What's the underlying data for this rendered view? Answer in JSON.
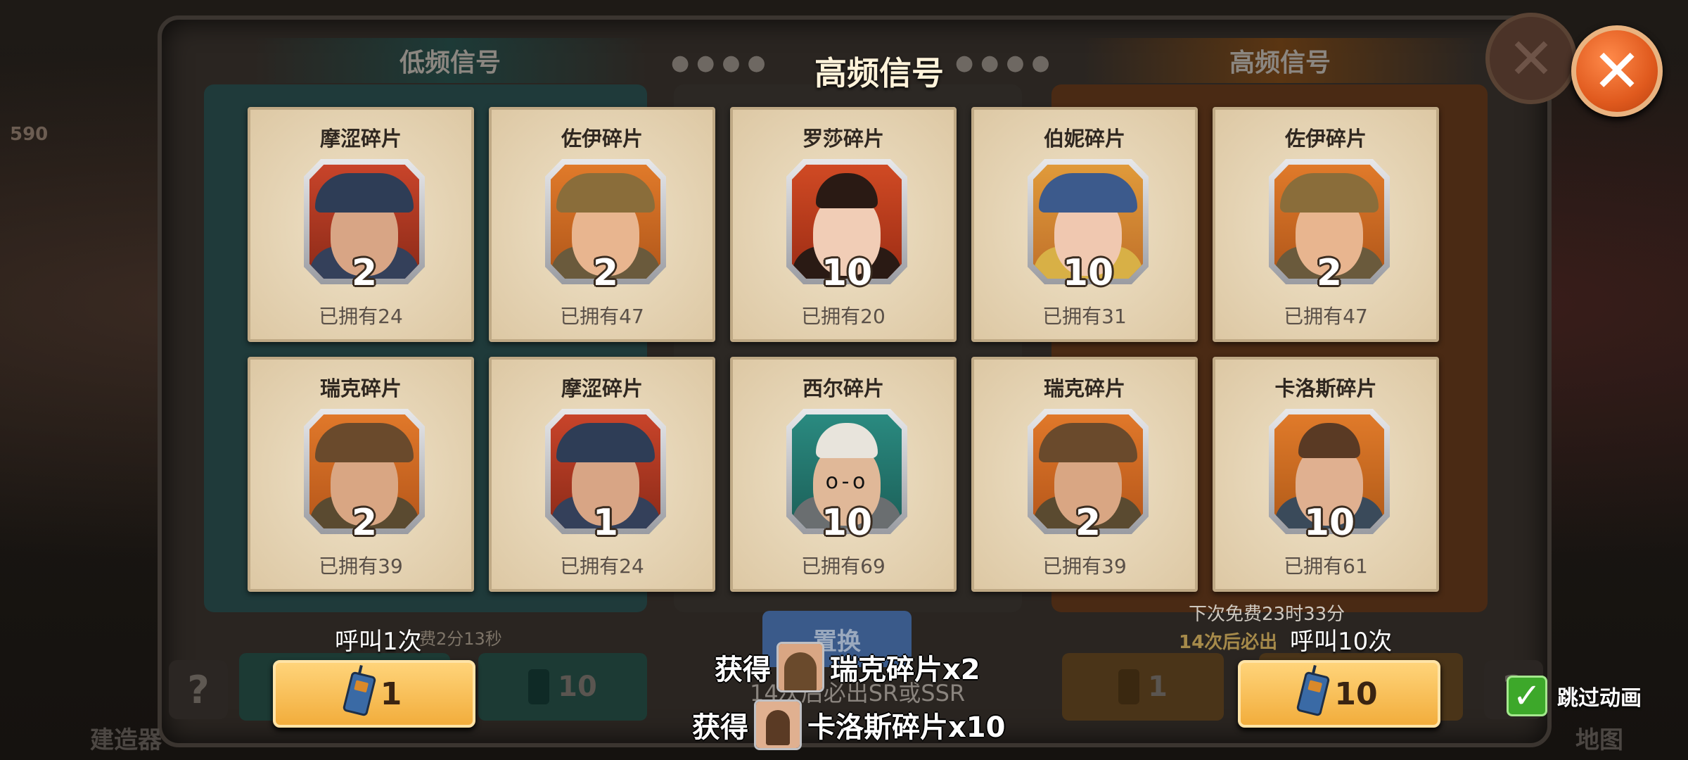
{
  "title": "高频信号",
  "tabs": {
    "low": "低频信号",
    "high": "高频信号"
  },
  "cards": [
    {
      "name": "摩涩碎片",
      "count": "2",
      "owned": "已拥有24",
      "hero": "mose"
    },
    {
      "name": "佐伊碎片",
      "count": "2",
      "owned": "已拥有47",
      "hero": "zoe"
    },
    {
      "name": "罗莎碎片",
      "count": "10",
      "owned": "已拥有20",
      "hero": "rosa"
    },
    {
      "name": "伯妮碎片",
      "count": "10",
      "owned": "已拥有31",
      "hero": "bonnie"
    },
    {
      "name": "佐伊碎片",
      "count": "2",
      "owned": "已拥有47",
      "hero": "zoe"
    },
    {
      "name": "瑞克碎片",
      "count": "2",
      "owned": "已拥有39",
      "hero": "rick"
    },
    {
      "name": "摩涩碎片",
      "count": "1",
      "owned": "已拥有24",
      "hero": "mose"
    },
    {
      "name": "西尔碎片",
      "count": "10",
      "owned": "已拥有69",
      "hero": "cyr"
    },
    {
      "name": "瑞克碎片",
      "count": "2",
      "owned": "已拥有39",
      "hero": "rick"
    },
    {
      "name": "卡洛斯碎片",
      "count": "10",
      "owned": "已拥有61",
      "hero": "carlos"
    }
  ],
  "call_once": {
    "label": "呼叫1次",
    "cost": "1"
  },
  "call_ten": {
    "label": "呼叫10次",
    "cost": "10"
  },
  "ghost": {
    "left_cost_10": "10",
    "right_cost_1": "1",
    "free_timer_left": "费2分13秒",
    "left_pity": "14次后必出SR或SSR",
    "swap": "置换",
    "build": "建造器",
    "map": "地图",
    "left_bubble": "590"
  },
  "free_next": "下次免费23时33分",
  "pity_right": "14次后必出",
  "rewards": [
    {
      "prefix": "获得",
      "text": "瑞克碎片x2",
      "hero": "rick"
    },
    {
      "prefix": "获得",
      "text": "卡洛斯碎片x10",
      "hero": "carlos"
    }
  ],
  "skip_label": "跳过动画",
  "help_glyph": "?",
  "colors": {
    "accent_orange": "#e05a1e",
    "card_bg": "#e6d6b8",
    "button_gold": "#f2ad3c",
    "check_green": "#3da82a"
  }
}
